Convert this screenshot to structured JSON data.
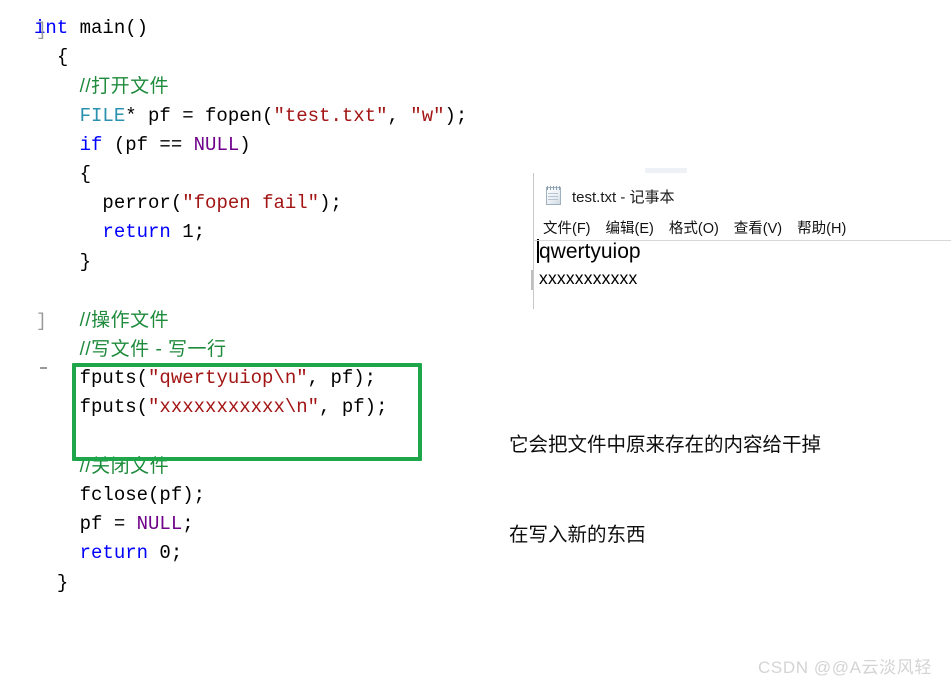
{
  "editor": {
    "gutter_markers": [
      "]",
      "]",
      "-"
    ],
    "lines": [
      {
        "indent": 0,
        "tokens": [
          {
            "t": "]",
            "c": "plain-gutter"
          },
          {
            "t": "int",
            "c": "kw"
          },
          {
            "t": " main()",
            "c": "plain"
          }
        ]
      },
      {
        "indent": 1,
        "tokens": [
          {
            "t": "{",
            "c": "plain"
          }
        ]
      },
      {
        "indent": 2,
        "tokens": [
          {
            "t": "//打开文件",
            "c": "comment"
          }
        ]
      },
      {
        "indent": 2,
        "tokens": [
          {
            "t": "FILE",
            "c": "type"
          },
          {
            "t": "* pf = fopen(",
            "c": "plain"
          },
          {
            "t": "\"test.txt\"",
            "c": "str"
          },
          {
            "t": ", ",
            "c": "plain"
          },
          {
            "t": "\"w\"",
            "c": "str"
          },
          {
            "t": ");",
            "c": "plain"
          }
        ]
      },
      {
        "indent": 2,
        "tokens": [
          {
            "t": "if",
            "c": "kw"
          },
          {
            "t": " (pf == ",
            "c": "plain"
          },
          {
            "t": "NULL",
            "c": "macro"
          },
          {
            "t": ")",
            "c": "plain"
          }
        ]
      },
      {
        "indent": 2,
        "tokens": [
          {
            "t": "{",
            "c": "plain"
          }
        ]
      },
      {
        "indent": 3,
        "tokens": [
          {
            "t": "perror(",
            "c": "plain"
          },
          {
            "t": "\"fopen fail\"",
            "c": "str"
          },
          {
            "t": ");",
            "c": "plain"
          }
        ]
      },
      {
        "indent": 3,
        "tokens": [
          {
            "t": "return",
            "c": "kw"
          },
          {
            "t": " 1;",
            "c": "plain"
          }
        ]
      },
      {
        "indent": 2,
        "tokens": [
          {
            "t": "}",
            "c": "plain"
          }
        ]
      },
      {
        "indent": 0,
        "tokens": [
          {
            "t": "",
            "c": "plain"
          }
        ]
      },
      {
        "indent": 2,
        "tokens": [
          {
            "t": "//操作文件",
            "c": "comment"
          }
        ]
      },
      {
        "indent": 2,
        "tokens": [
          {
            "t": "//写文件 - 写一行",
            "c": "comment"
          }
        ]
      },
      {
        "indent": 2,
        "tokens": [
          {
            "t": "fputs(",
            "c": "plain"
          },
          {
            "t": "\"qwertyuiop\\n\"",
            "c": "str"
          },
          {
            "t": ", pf);",
            "c": "plain"
          }
        ]
      },
      {
        "indent": 2,
        "tokens": [
          {
            "t": "fputs(",
            "c": "plain"
          },
          {
            "t": "\"xxxxxxxxxxx\\n\"",
            "c": "str"
          },
          {
            "t": ", pf);",
            "c": "plain"
          }
        ]
      },
      {
        "indent": 0,
        "tokens": [
          {
            "t": "",
            "c": "plain"
          }
        ]
      },
      {
        "indent": 2,
        "tokens": [
          {
            "t": "//关闭文件",
            "c": "comment"
          }
        ]
      },
      {
        "indent": 2,
        "tokens": [
          {
            "t": "fclose(pf);",
            "c": "plain"
          }
        ]
      },
      {
        "indent": 2,
        "tokens": [
          {
            "t": "pf = ",
            "c": "plain"
          },
          {
            "t": "NULL",
            "c": "macro"
          },
          {
            "t": ";",
            "c": "plain"
          }
        ]
      },
      {
        "indent": 2,
        "tokens": [
          {
            "t": "return",
            "c": "kw"
          },
          {
            "t": " 0;",
            "c": "plain"
          }
        ]
      },
      {
        "indent": 1,
        "tokens": [
          {
            "t": "}",
            "c": "plain"
          }
        ]
      }
    ]
  },
  "highlight": {
    "label": "fputs-highlight-box",
    "color": "#1FA64A"
  },
  "notepad": {
    "title": "test.txt - 记事本",
    "icon": "notepad-icon",
    "menu": [
      "文件(F)",
      "编辑(E)",
      "格式(O)",
      "查看(V)",
      "帮助(H)"
    ],
    "content_lines": [
      "qwertyuiop",
      "xxxxxxxxxxx"
    ],
    "ghost_top_left": "",
    "ghost_top_right": ""
  },
  "annotation": {
    "line1": "它会把文件中原来存在的内容给干掉",
    "line2": "在写入新的东西"
  },
  "watermark": {
    "text": "CSDN @@A云淡风轻"
  },
  "colors": {
    "keyword": "#0000FF",
    "type": "#2B91AF",
    "macro": "#6F008A",
    "string": "#A31515",
    "comment": "#1E8B3C",
    "highlight_box": "#1FA64A",
    "watermark": "#D4D4D4"
  }
}
